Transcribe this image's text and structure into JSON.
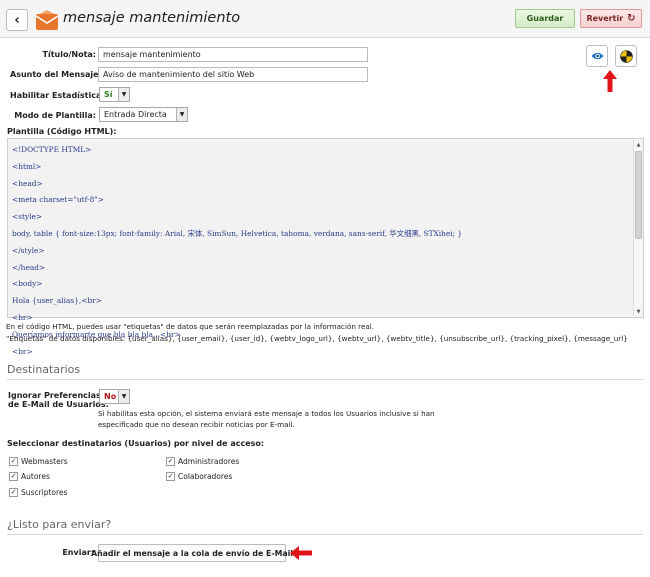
{
  "header": {
    "title": "mensaje mantenimiento",
    "save_label": "Guardar",
    "revert_label": "Revertir"
  },
  "form": {
    "title_label": "Título/Nota:",
    "title_value": "mensaje mantenimiento",
    "subject_label": "Asunto del Mensaje:",
    "subject_value": "Aviso de mantenimiento del sitio Web",
    "stats_label": "Habilitar Estadísticas:",
    "stats_value": "Sí",
    "mode_label": "Modo de Plantilla:",
    "mode_value": "Entrada Directa",
    "template_label": "Plantilla (Código HTML):"
  },
  "code_lines": [
    "<!DOCTYPE HTML>",
    "<html>",
    "<head>",
    "<meta charset=\"utf-8\">",
    "<style>",
    "body, table { font-size:13px; font-family: Arial, 宋体, SimSun, Helvetica, tahoma, verdana, sans-serif, 华文细黑, STXihei; }",
    "</style>",
    "</head>",
    "<body>",
    "Hola {user_alias},<br>",
    "<br>",
    "Queríamos informarte que bla bla bla...<br>",
    "<br>"
  ],
  "help": {
    "line1": "En el código HTML, puedes usar \"etiquetas\" de datos que serán reemplazadas por la información real.",
    "line2": "\"Etiquetas\" de datos disponibles: {user_alias}, {user_email}, {user_id}, {webtv_logo_url}, {webtv_url}, {webtv_title}, {unsubscribe_url}, {tracking_pixel}, {message_url}"
  },
  "recipients": {
    "section_title": "Destinatarios",
    "ignore_label_line1": "Ignorar Preferencias",
    "ignore_label_line2": "de E-Mail de Usuarios:",
    "ignore_value": "No",
    "ignore_help_line1": "Si habilitas esta opción, el sistema enviará este mensaje a todos los Usuarios inclusive si han",
    "ignore_help_line2": "especificado que no desean recibir noticias por E-mail.",
    "levels_title": "Seleccionar destinatarios (Usuarios) por nivel de acceso:",
    "levels": [
      {
        "label": "Webmasters",
        "checked": true
      },
      {
        "label": "Autores",
        "checked": true
      },
      {
        "label": "Suscriptores",
        "checked": true
      },
      {
        "label": "Administradores",
        "checked": true
      },
      {
        "label": "Colaboradores",
        "checked": true
      }
    ]
  },
  "send": {
    "section_title": "¿Listo para enviar?",
    "label": "Enviar:",
    "button_label": "Añadir el mensaje a la cola de envío de E-Mail"
  },
  "colors": {
    "annotation_arrow": "#e0151b",
    "save_green": "#2c5a1a",
    "revert_red": "#7a2323",
    "code_text": "#2a3a8a"
  }
}
